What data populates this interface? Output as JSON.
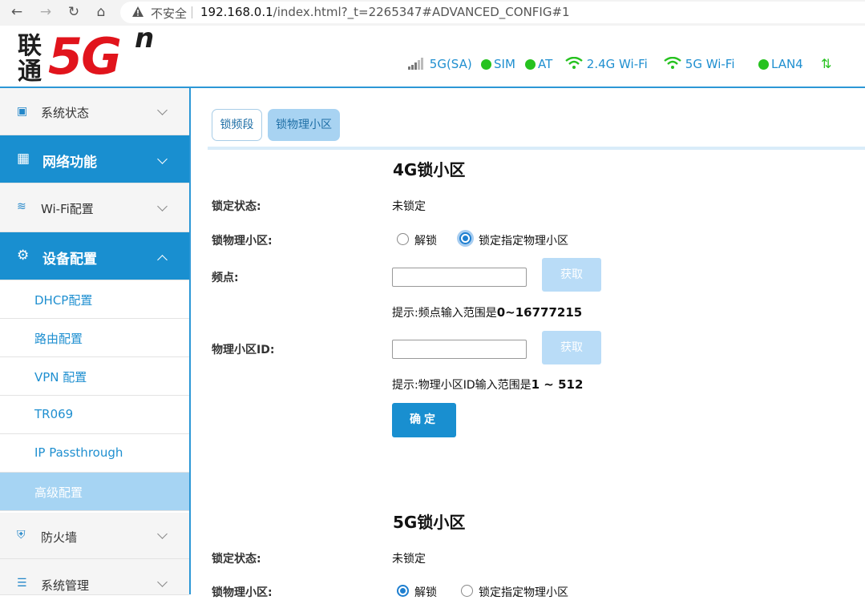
{
  "browser": {
    "insecure_label": "不安全",
    "url_host": "192.168.0.1",
    "url_path": "/index.html?_t=2265347#ADVANCED_CONFIG#1"
  },
  "header": {
    "logo_cn": "联通",
    "logo_5g": "5G",
    "logo_n": "n",
    "status": {
      "network": "5G(SA)",
      "sim": "SIM",
      "at": "AT",
      "wifi24": "2.4G Wi-Fi",
      "wifi5": "5G Wi-Fi",
      "lan": "LAN4"
    },
    "status_color": "#26c21f",
    "accent_color": "#198fd0"
  },
  "sidebar": {
    "items": [
      {
        "label": "系统状态",
        "icon": "monitor-icon"
      },
      {
        "label": "网络功能",
        "icon": "grid-icon"
      },
      {
        "label": "Wi-Fi配置",
        "icon": "wifi-icon"
      },
      {
        "label": "设备配置",
        "icon": "gear-icon"
      },
      {
        "label": "防火墙",
        "icon": "shield-icon"
      },
      {
        "label": "系统管理",
        "icon": "sliders-icon"
      }
    ],
    "subitems": [
      "DHCP配置",
      "路由配置",
      "VPN 配置",
      "TR069",
      "IP Passthrough",
      "高级配置"
    ]
  },
  "tabs": [
    "锁频段",
    "锁物理小区"
  ],
  "lock4g": {
    "title": "4G锁小区",
    "status_label": "锁定状态:",
    "status_value": "未锁定",
    "cell_label": "锁物理小区:",
    "opt_unlock": "解锁",
    "opt_lock": "锁定指定物理小区",
    "freq_label": "频点:",
    "freq_value": "",
    "get_btn": "获取",
    "freq_hint_prefix": "提示:频点输入范围是",
    "freq_hint_range": "0~16777215",
    "pci_label": "物理小区ID:",
    "pci_value": "",
    "pci_hint_prefix": "提示:物理小区ID输入范围是",
    "pci_hint_range": "1 ~ 512",
    "ok_btn": "确定"
  },
  "lock5g": {
    "title": "5G锁小区",
    "status_label": "锁定状态:",
    "status_value": "未锁定",
    "cell_label": "锁物理小区:",
    "opt_unlock": "解锁",
    "opt_lock": "锁定指定物理小区"
  }
}
